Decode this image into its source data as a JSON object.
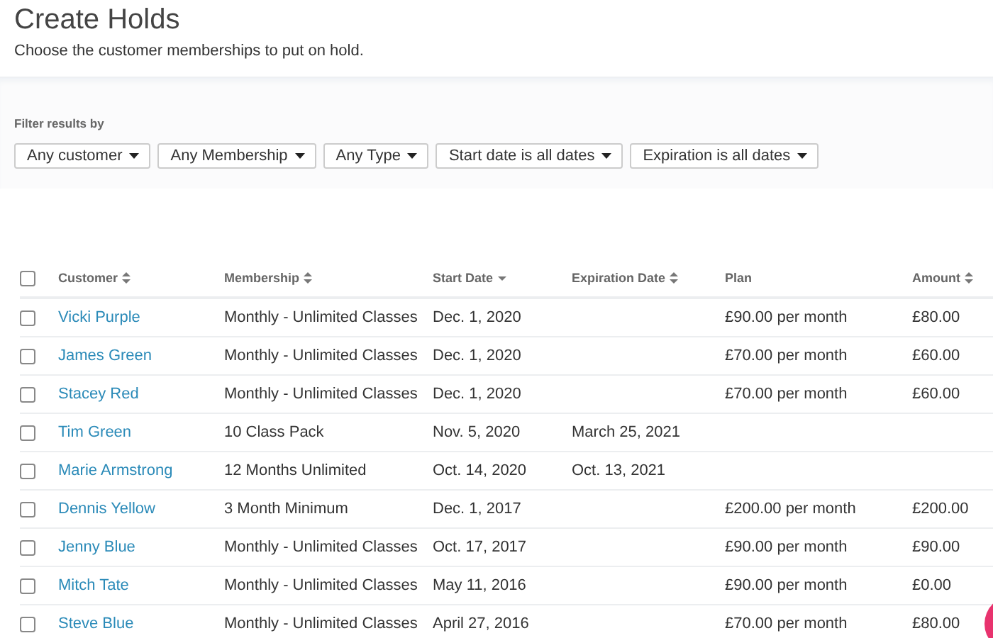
{
  "page": {
    "title": "Create Holds",
    "subtitle": "Choose the customer memberships to put on hold."
  },
  "filters": {
    "label": "Filter results by",
    "dropdowns": [
      "Any customer",
      "Any Membership",
      "Any Type",
      "Start date is all dates",
      "Expiration is all dates"
    ]
  },
  "table": {
    "select_all": {
      "checked": false
    },
    "columns": [
      {
        "label": "Customer",
        "sortable": true,
        "sorted": false
      },
      {
        "label": "Membership",
        "sortable": true,
        "sorted": false
      },
      {
        "label": "Start Date",
        "sortable": true,
        "sorted": true
      },
      {
        "label": "Expiration Date",
        "sortable": true,
        "sorted": false
      },
      {
        "label": "Plan",
        "sortable": false,
        "sorted": false
      },
      {
        "label": "Amount",
        "sortable": true,
        "sorted": false
      }
    ],
    "rows": [
      {
        "checked": false,
        "customer": "Vicki Purple",
        "membership": "Monthly - Unlimited Classes",
        "start_date": "Dec. 1, 2020",
        "expiration_date": "",
        "plan": "£90.00 per month",
        "amount": "£80.00"
      },
      {
        "checked": false,
        "customer": "James Green",
        "membership": "Monthly - Unlimited Classes",
        "start_date": "Dec. 1, 2020",
        "expiration_date": "",
        "plan": "£70.00 per month",
        "amount": "£60.00"
      },
      {
        "checked": false,
        "customer": "Stacey Red",
        "membership": "Monthly - Unlimited Classes",
        "start_date": "Dec. 1, 2020",
        "expiration_date": "",
        "plan": "£70.00 per month",
        "amount": "£60.00"
      },
      {
        "checked": false,
        "customer": "Tim Green",
        "membership": "10 Class Pack",
        "start_date": "Nov. 5, 2020",
        "expiration_date": "March 25, 2021",
        "plan": "",
        "amount": ""
      },
      {
        "checked": false,
        "customer": "Marie Armstrong",
        "membership": "12 Months Unlimited",
        "start_date": "Oct. 14, 2020",
        "expiration_date": "Oct. 13, 2021",
        "plan": "",
        "amount": ""
      },
      {
        "checked": false,
        "customer": "Dennis Yellow",
        "membership": "3 Month Minimum",
        "start_date": "Dec. 1, 2017",
        "expiration_date": "",
        "plan": "£200.00 per month",
        "amount": "£200.00"
      },
      {
        "checked": false,
        "customer": "Jenny Blue",
        "membership": "Monthly - Unlimited Classes",
        "start_date": "Oct. 17, 2017",
        "expiration_date": "",
        "plan": "£90.00 per month",
        "amount": "£90.00"
      },
      {
        "checked": false,
        "customer": "Mitch Tate",
        "membership": "Monthly - Unlimited Classes",
        "start_date": "May 11, 2016",
        "expiration_date": "",
        "plan": "£90.00 per month",
        "amount": "£0.00"
      },
      {
        "checked": false,
        "customer": "Steve Blue",
        "membership": "Monthly - Unlimited Classes",
        "start_date": "April 27, 2016",
        "expiration_date": "",
        "plan": "£70.00 per month",
        "amount": "£80.00"
      }
    ]
  }
}
